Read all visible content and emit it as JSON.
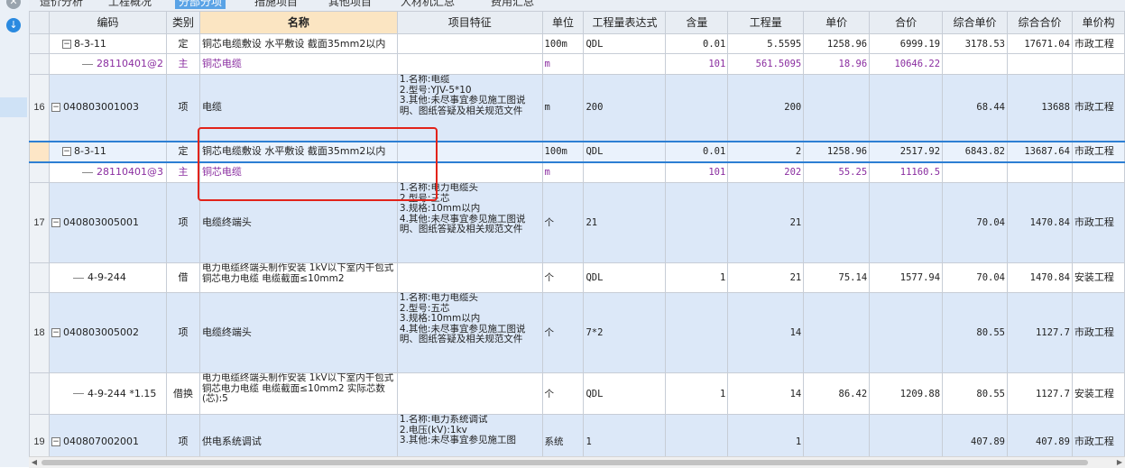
{
  "tabs": [
    "造价分析",
    "工程概况",
    "分部分项",
    "措施项目",
    "其他项目",
    "人材机汇总",
    "费用汇总"
  ],
  "active_tab_index": 2,
  "columns": [
    "编码",
    "类别",
    "名称",
    "项目特征",
    "单位",
    "工程量表达式",
    "含量",
    "工程量",
    "单价",
    "合价",
    "综合单价",
    "综合合价",
    "单价构"
  ],
  "rows": [
    {
      "rn": "",
      "code": "8-3-11",
      "type": "定",
      "name": "铜芯电缆敷设 水平敷设 截面35mm2以内",
      "feat": "",
      "unit": "100m",
      "expr": "QDL",
      "qty": "0.01",
      "amount": "5.5595",
      "price": "1258.96",
      "total": "6999.19",
      "cprice": "3178.53",
      "ctotal": "17671.04",
      "ptype": "市政工程"
    },
    {
      "rn": "",
      "code": "28110401@2",
      "type": "主",
      "name": "铜芯电缆",
      "feat": "",
      "unit": "m",
      "expr": "",
      "qty": "101",
      "amount": "561.5095",
      "price": "18.96",
      "total": "10646.22",
      "cprice": "",
      "ctotal": "",
      "ptype": ""
    },
    {
      "rn": "16",
      "code": "040803001003",
      "type": "项",
      "name": "电缆",
      "feat": "1.名称:电缆\n2.型号:YJV-5*10\n3.其他:未尽事宜参见施工图说明、图纸答疑及相关规范文件",
      "unit": "m",
      "expr": "200",
      "qty": "",
      "amount": "200",
      "price": "",
      "total": "",
      "cprice": "68.44",
      "ctotal": "13688",
      "ptype": "市政工程"
    },
    {
      "rn": "",
      "code": "8-3-11",
      "type": "定",
      "name": "铜芯电缆敷设 水平敷设 截面35mm2以内",
      "feat": "",
      "unit": "100m",
      "expr": "QDL",
      "qty": "0.01",
      "amount": "2",
      "price": "1258.96",
      "total": "2517.92",
      "cprice": "6843.82",
      "ctotal": "13687.64",
      "ptype": "市政工程"
    },
    {
      "rn": "",
      "code": "28110401@3",
      "type": "主",
      "name": "铜芯电缆",
      "feat": "",
      "unit": "m",
      "expr": "",
      "qty": "101",
      "amount": "202",
      "price": "55.25",
      "total": "11160.5",
      "cprice": "",
      "ctotal": "",
      "ptype": ""
    },
    {
      "rn": "17",
      "code": "040803005001",
      "type": "项",
      "name": "电缆终端头",
      "feat": "1.名称:电力电缆头\n2.型号:三芯\n3.规格:10mm以内\n4.其他:未尽事宜参见施工图说明、图纸答疑及相关规范文件",
      "unit": "个",
      "expr": "21",
      "qty": "",
      "amount": "21",
      "price": "",
      "total": "",
      "cprice": "70.04",
      "ctotal": "1470.84",
      "ptype": "市政工程"
    },
    {
      "rn": "",
      "code": "4-9-244",
      "type": "借",
      "name": "电力电缆终端头制作安装 1kV以下室内干包式铜芯电力电缆 电缆截面≤10mm2",
      "feat": "",
      "unit": "个",
      "expr": "QDL",
      "qty": "1",
      "amount": "21",
      "price": "75.14",
      "total": "1577.94",
      "cprice": "70.04",
      "ctotal": "1470.84",
      "ptype": "安装工程"
    },
    {
      "rn": "18",
      "code": "040803005002",
      "type": "项",
      "name": "电缆终端头",
      "feat": "1.名称:电力电缆头\n2.型号:五芯\n3.规格:10mm以内\n4.其他:未尽事宜参见施工图说明、图纸答疑及相关规范文件",
      "unit": "个",
      "expr": "7*2",
      "qty": "",
      "amount": "14",
      "price": "",
      "total": "",
      "cprice": "80.55",
      "ctotal": "1127.7",
      "ptype": "市政工程"
    },
    {
      "rn": "",
      "code": "4-9-244 *1.15",
      "type": "借换",
      "name": "电力电缆终端头制作安装 1kV以下室内干包式铜芯电力电缆 电缆截面≤10mm2 实际芯数(芯):5",
      "feat": "",
      "unit": "个",
      "expr": "QDL",
      "qty": "1",
      "amount": "14",
      "price": "86.42",
      "total": "1209.88",
      "cprice": "80.55",
      "ctotal": "1127.7",
      "ptype": "安装工程"
    },
    {
      "rn": "19",
      "code": "040807002001",
      "type": "项",
      "name": "供电系统调试",
      "feat": "1.名称:电力系统调试\n2.电压(kV):1kv\n3.其他:未尽事宜参见施工图",
      "unit": "系统",
      "expr": "1",
      "qty": "",
      "amount": "1",
      "price": "",
      "total": "",
      "cprice": "407.89",
      "ctotal": "407.89",
      "ptype": "市政工程"
    }
  ]
}
